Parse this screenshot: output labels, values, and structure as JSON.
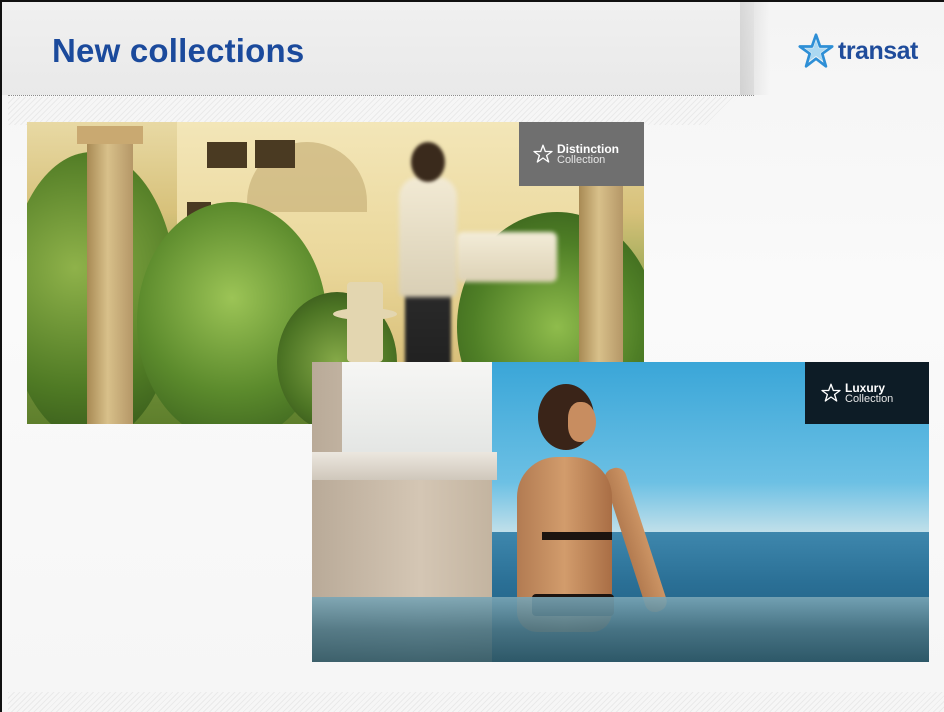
{
  "slide": {
    "title": "New collections",
    "logo": {
      "icon": "transat-star-icon",
      "text": "transat",
      "color": "#1f4c9b"
    }
  },
  "photos": [
    {
      "description_icon": "courtyard-photo",
      "badge": {
        "icon": "star-outline-icon",
        "title": "Distinction",
        "subtitle": "Collection",
        "color": "#6f6f6f"
      }
    },
    {
      "description_icon": "infinity-pool-photo",
      "badge": {
        "icon": "star-outline-icon",
        "title": "Luxury",
        "subtitle": "Collection",
        "color": "#0d1c26"
      }
    }
  ],
  "colors": {
    "title": "#1b4a9c"
  }
}
